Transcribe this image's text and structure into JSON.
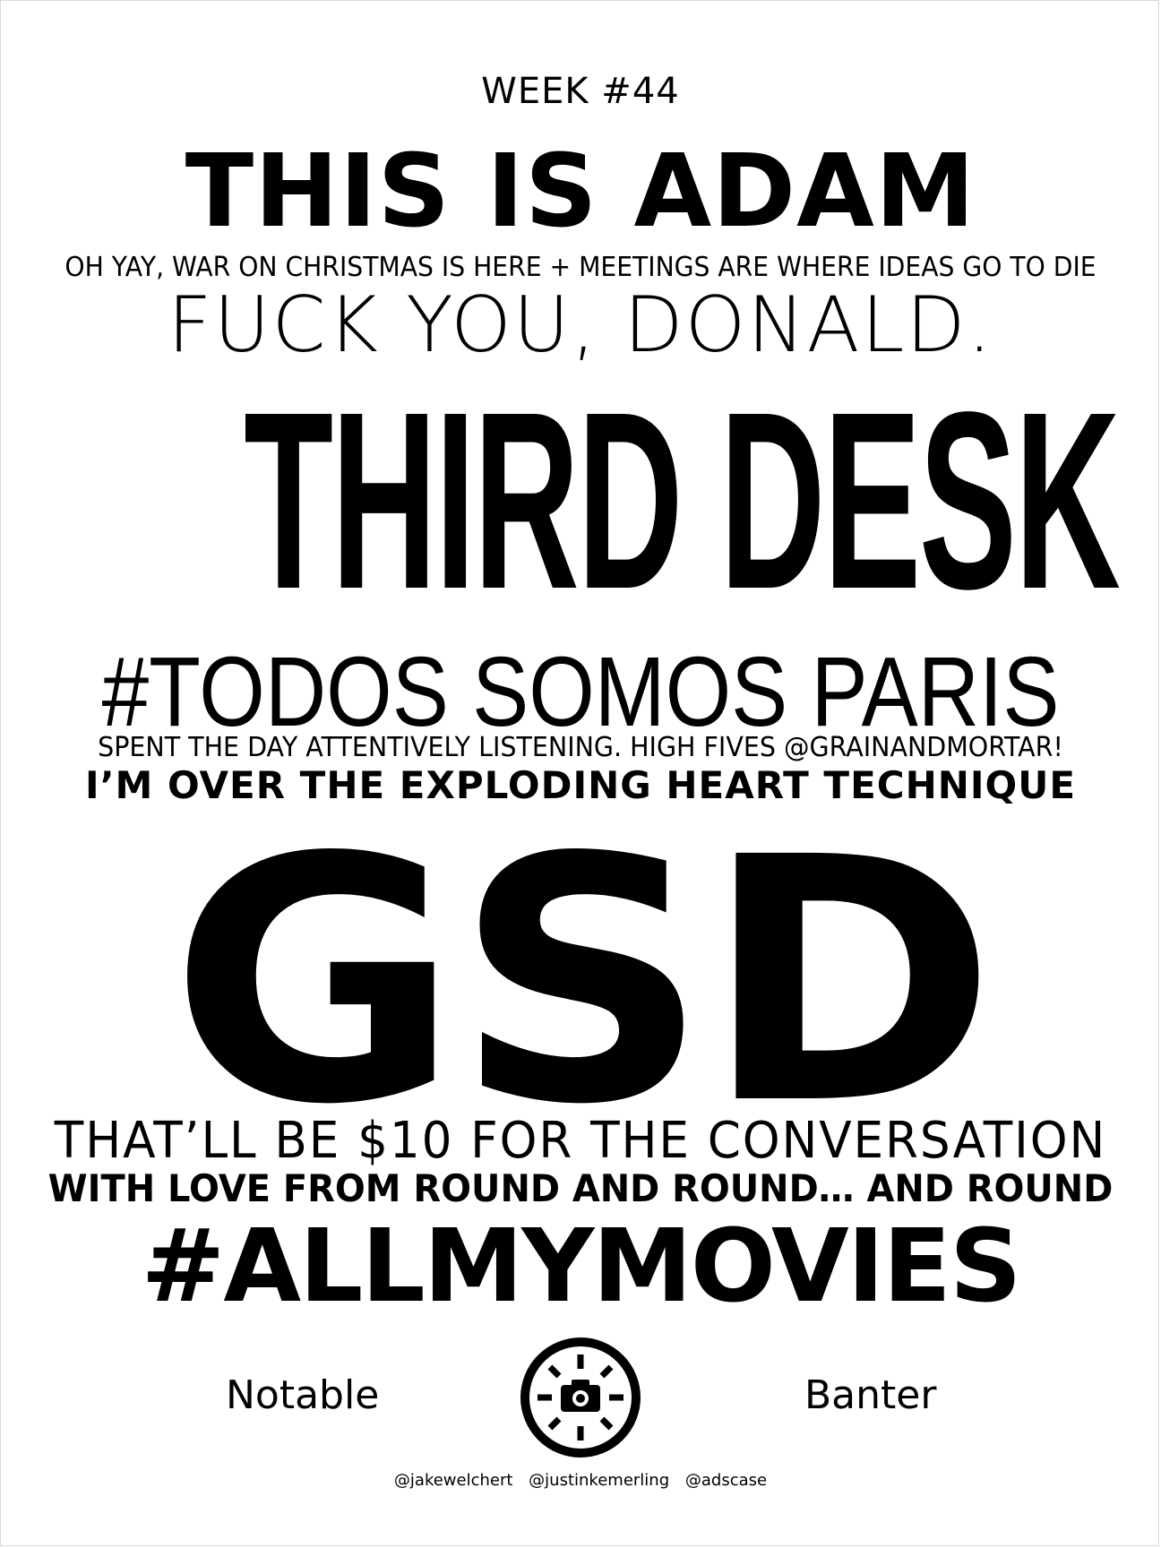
{
  "poster": {
    "week": "WEEK #44",
    "lines": [
      "THIS IS ADAM",
      "OH YAY, WAR ON CHRISTMAS IS HERE + MEETINGS ARE WHERE IDEAS GO TO DIE",
      "FUCK YOU, DONALD.",
      "THIRD DESK",
      "#TODOS SOMOS PARIS",
      "SPENT THE DAY ATTENTIVELY LISTENING. HIGH FIVES @GRAINANDMORTAR!",
      "I’M OVER THE EXPLODING HEART TECHNIQUE",
      "GSD",
      "THAT’LL BE $10 FOR THE CONVERSATION",
      "WITH LOVE FROM ROUND AND ROUND… AND ROUND",
      "#ALLMYMOVIES"
    ]
  },
  "footer": {
    "left_word": "Notable",
    "right_word": "Banter",
    "logo_icon": "camera-sun-icon",
    "handles": [
      "@jakewelchert",
      "@justinkemerling",
      "@adscase"
    ]
  }
}
